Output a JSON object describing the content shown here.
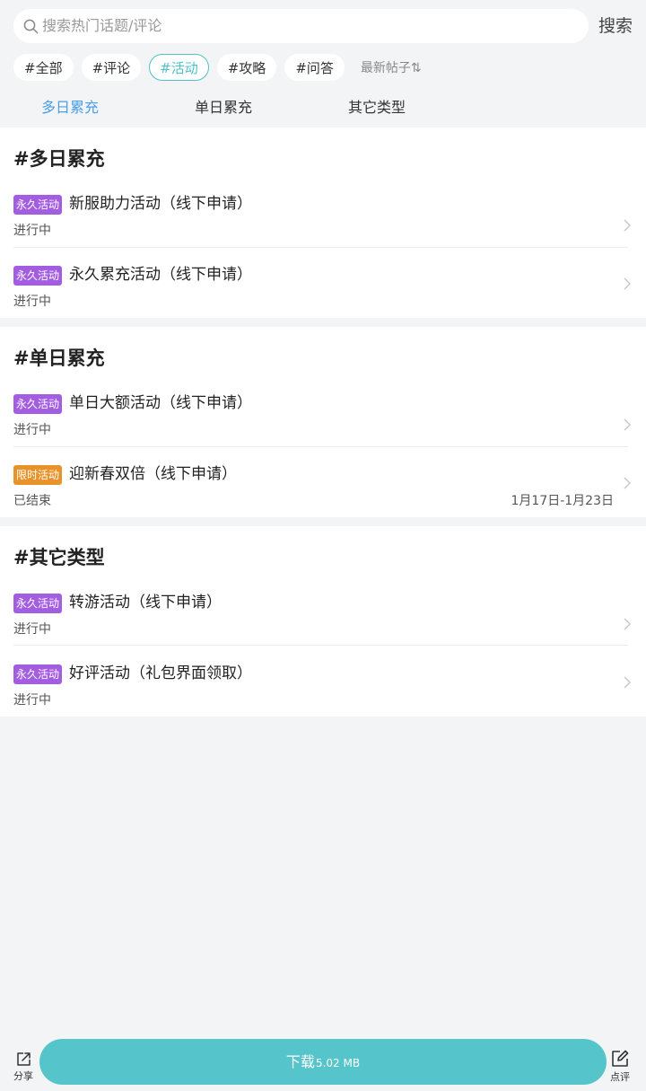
{
  "search": {
    "placeholder": "搜索热门话题/评论",
    "button_label": "搜索"
  },
  "tags": [
    {
      "label": "#全部",
      "active": false
    },
    {
      "label": "#评论",
      "active": false
    },
    {
      "label": "#活动",
      "active": true
    },
    {
      "label": "#攻略",
      "active": false
    },
    {
      "label": "#问答",
      "active": false
    }
  ],
  "sort_label": "最新帖子⇅",
  "subtabs": [
    {
      "label": "多日累充",
      "active": true
    },
    {
      "label": "单日累充",
      "active": false
    },
    {
      "label": "其它类型",
      "active": false
    }
  ],
  "sections": [
    {
      "title": "#多日累充",
      "items": [
        {
          "badge": "永久活动",
          "badge_color": "#a35de0",
          "title": "新服助力活动（线下申请）",
          "status": "进行中",
          "date": ""
        },
        {
          "badge": "永久活动",
          "badge_color": "#a35de0",
          "title": "永久累充活动（线下申请）",
          "status": "进行中",
          "date": ""
        }
      ]
    },
    {
      "title": "#单日累充",
      "items": [
        {
          "badge": "永久活动",
          "badge_color": "#a35de0",
          "title": "单日大额活动（线下申请）",
          "status": "进行中",
          "date": ""
        },
        {
          "badge": "限时活动",
          "badge_color": "#e9922a",
          "title": "迎新春双倍（线下申请）",
          "status": "已结束",
          "date": "1月17日-1月23日"
        }
      ]
    },
    {
      "title": "#其它类型",
      "items": [
        {
          "badge": "永久活动",
          "badge_color": "#a35de0",
          "title": "转游活动（线下申请）",
          "status": "进行中",
          "date": ""
        },
        {
          "badge": "永久活动",
          "badge_color": "#a35de0",
          "title": "好评活动（礼包界面领取）",
          "status": "进行中",
          "date": ""
        }
      ]
    }
  ],
  "bottom": {
    "share_label": "分享",
    "download_label": "下载",
    "download_size": "5.02 MB",
    "review_label": "点评"
  },
  "colors": {
    "accent_teal": "#56c4cb",
    "tab_active_blue": "#4a9ee8",
    "badge_permanent": "#a35de0",
    "badge_limited": "#e9922a"
  }
}
